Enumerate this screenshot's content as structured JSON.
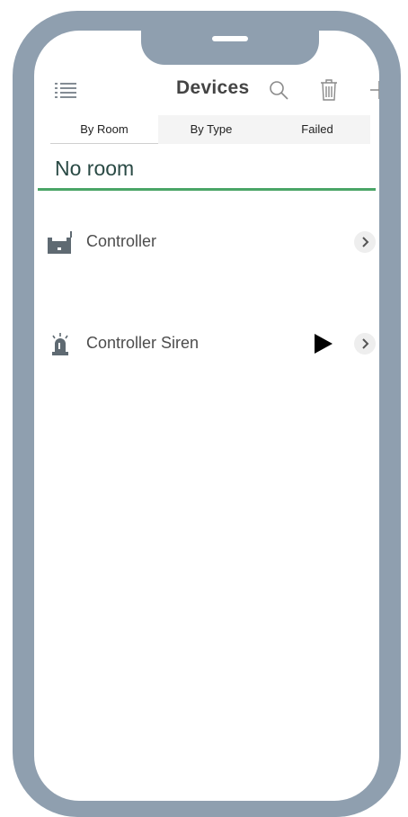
{
  "header": {
    "title": "Devices",
    "icons": [
      "menu-icon",
      "search-icon",
      "trash-icon",
      "plus-icon"
    ]
  },
  "tabs": [
    {
      "label": "By Room",
      "active": true
    },
    {
      "label": "By Type",
      "active": false
    },
    {
      "label": "Failed",
      "active": false
    }
  ],
  "section": {
    "title": "No room"
  },
  "devices": [
    {
      "label": "Controller",
      "icon": "controller-icon",
      "has_play": false
    },
    {
      "label": "Controller Siren",
      "icon": "siren-icon",
      "has_play": true
    }
  ],
  "colors": {
    "frame": "#8f9faf",
    "accent": "#4aa567",
    "title": "#444444"
  }
}
